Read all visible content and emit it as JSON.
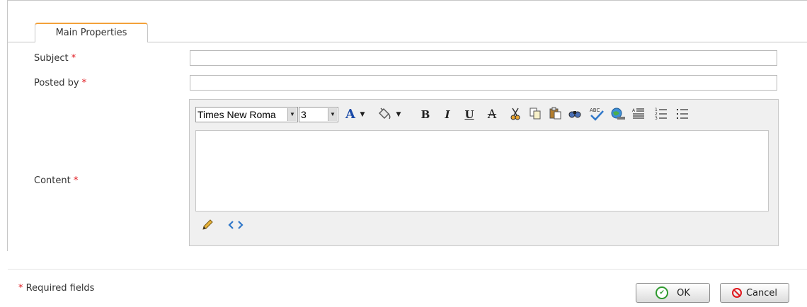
{
  "tab": {
    "label": "Main Properties"
  },
  "form": {
    "subject_label": "Subject",
    "posted_by_label": "Posted by",
    "content_label": "Content",
    "required_mark": "*",
    "subject_value": "",
    "posted_by_value": ""
  },
  "editor": {
    "font_name": "Times New Roma",
    "font_size": "3",
    "font_color_glyph": "A",
    "bold": "B",
    "italic": "I",
    "underline": "U",
    "strike": "A"
  },
  "footer": {
    "required_text": "Required fields",
    "ok_label": "OK",
    "cancel_label": "Cancel"
  },
  "colors": {
    "accent_tab": "#f3a13a",
    "required": "#e0161c",
    "ok_icon": "#2f9a2f",
    "cancel_icon": "#e0161c"
  }
}
